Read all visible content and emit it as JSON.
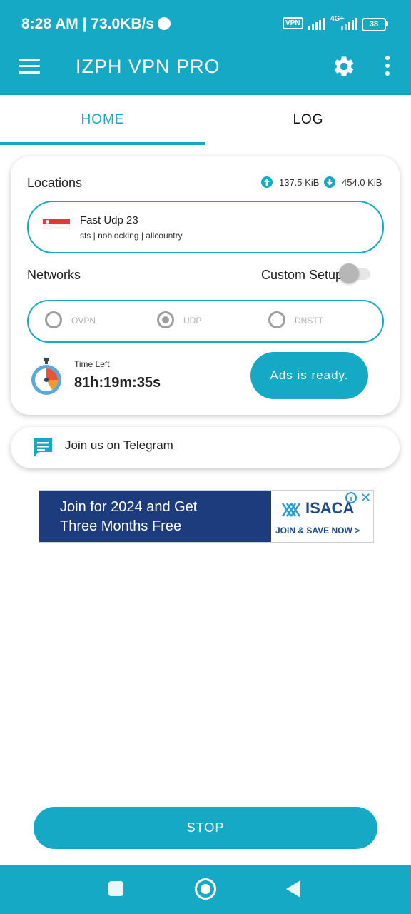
{
  "status_bar": {
    "time_speed": "8:28 AM | 73.0KB/s",
    "vpn_badge": "VPN",
    "network_type": "4G+",
    "battery": "38"
  },
  "app_bar": {
    "title": "IZPH VPN PRO",
    "menu_icon": "hamburger-menu-icon",
    "settings_icon": "gear-icon",
    "more_icon": "vertical-dots-icon"
  },
  "tabs": [
    {
      "label": "HOME",
      "active": true
    },
    {
      "label": "LOG",
      "active": false
    }
  ],
  "locations": {
    "label": "Locations",
    "upload": "137.5 KiB",
    "download": "454.0 KiB",
    "server_name": "Fast Udp 23",
    "server_tags": "sts | noblocking | allcountry",
    "flag": "singapore-flag"
  },
  "networks": {
    "label": "Networks",
    "custom_setup_label": "Custom Setup",
    "custom_setup_enabled": false,
    "options": [
      {
        "label": "OVPN",
        "selected": false
      },
      {
        "label": "UDP",
        "selected": true
      },
      {
        "label": "DNSTT",
        "selected": false
      }
    ]
  },
  "timer": {
    "label": "Time Left",
    "value": "81h:19m:35s",
    "icon": "stopwatch-icon"
  },
  "ads_button": {
    "label": "Ads is ready."
  },
  "telegram": {
    "label": "Join us on Telegram",
    "icon": "chat-message-icon"
  },
  "ad_banner": {
    "text_line1": "Join for 2024 and Get",
    "text_line2": "Three Months Free",
    "brand": "ISACA",
    "cta": "JOIN & SAVE NOW >"
  },
  "stop_button": {
    "label": "STOP"
  },
  "colors": {
    "primary": "#16a9c6",
    "flag_red": "#e8353a",
    "ad_blue": "#1c3c7e"
  }
}
